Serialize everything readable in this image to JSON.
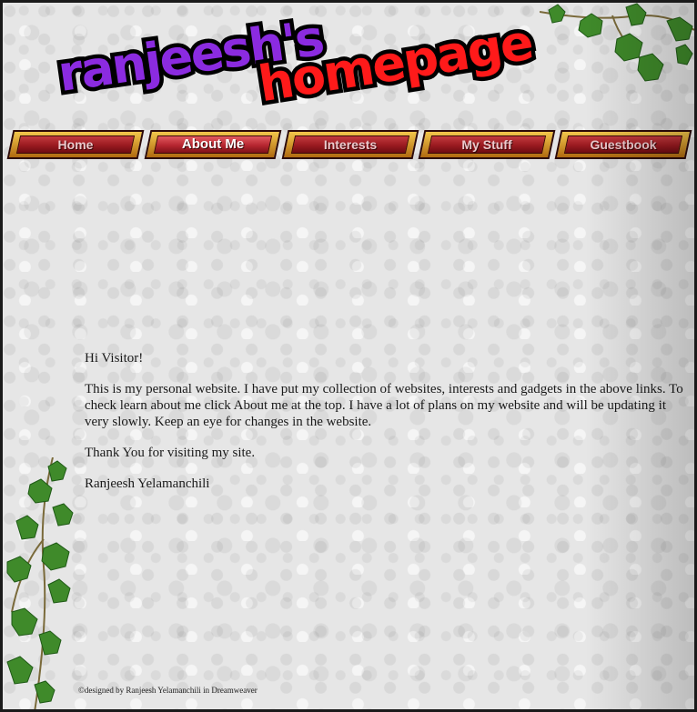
{
  "logo": {
    "word1": "ranjeesh's",
    "word2": "homepage",
    "color1": "#8b2be0",
    "color2": "#ff1a1a"
  },
  "nav": {
    "items": [
      {
        "label": "Home",
        "active": false
      },
      {
        "label": "About Me",
        "active": true
      },
      {
        "label": "Interests",
        "active": false
      },
      {
        "label": "My Stuff",
        "active": false
      },
      {
        "label": "Guestbook",
        "active": false
      }
    ],
    "accent": "#9a1a20"
  },
  "main": {
    "greeting": "Hi Visitor!",
    "intro": "This is my personal website. I have put my collection of websites, interests and gadgets in the above links. To check learn about me click About me at the top. I have a lot of plans on my website and will be updating it very slowly. Keep an eye for changes in the website.",
    "thanks": "Thank You for visiting my site.",
    "signature": "Ranjeesh Yelamanchili"
  },
  "footer": {
    "credit": "©designed by Ranjeesh Yelamanchili in Dreamweaver"
  },
  "icons": [
    "ivy-vine-icon"
  ]
}
